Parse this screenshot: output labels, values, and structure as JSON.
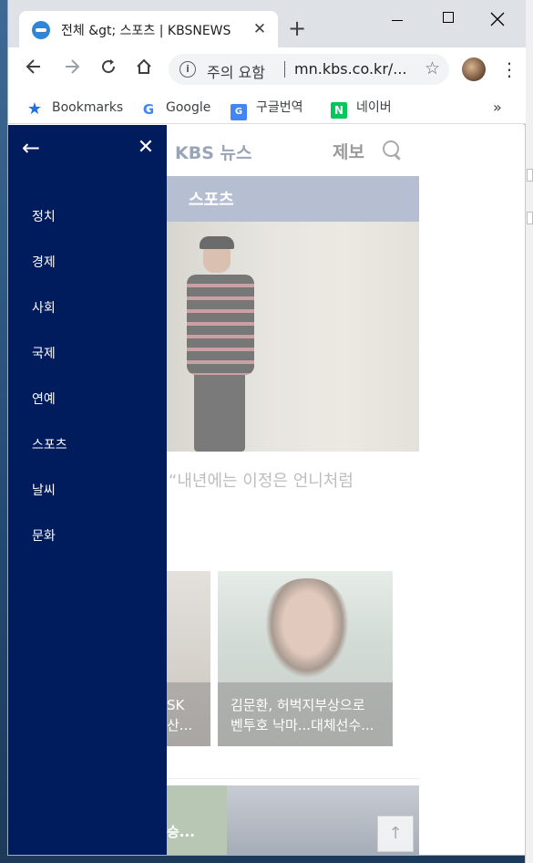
{
  "browser": {
    "tab_title": "전체 &gt; 스포츠 | KBSNEWS",
    "tab_close": "✕",
    "new_tab": "+",
    "omnibox_warning": "주의 요함",
    "omnibox_url": "mn.kbs.co.kr/...",
    "bookmarks": [
      {
        "label": "Bookmarks",
        "icon": "star-icon"
      },
      {
        "label": "Google",
        "icon": "google-icon"
      },
      {
        "label": "구글번역",
        "icon": "translate-icon"
      },
      {
        "label": "네이버",
        "icon": "naver-icon"
      }
    ],
    "bookmarks_more": "»"
  },
  "page": {
    "logo": "KBS 뉴스",
    "report_link": "제보",
    "section_band": "스포츠",
    "hero_caption": "“내년에는 이정은 언니처럼",
    "card1_text": [
      "SK",
      "산..."
    ],
    "card2_text": [
      "김문환, 허벅지부상으로",
      "벤투호 낙마...대체선수..."
    ],
    "bottom_card_text": "승...",
    "scroll_top": "↑"
  },
  "drawer": {
    "back_icon": "←",
    "close_icon": "✕",
    "menu": [
      "정치",
      "경제",
      "사회",
      "국제",
      "연예",
      "스포츠",
      "날씨",
      "문화"
    ]
  },
  "colors": {
    "drawer_bg": "#001c5d",
    "section_band": "#b5bfd1"
  }
}
